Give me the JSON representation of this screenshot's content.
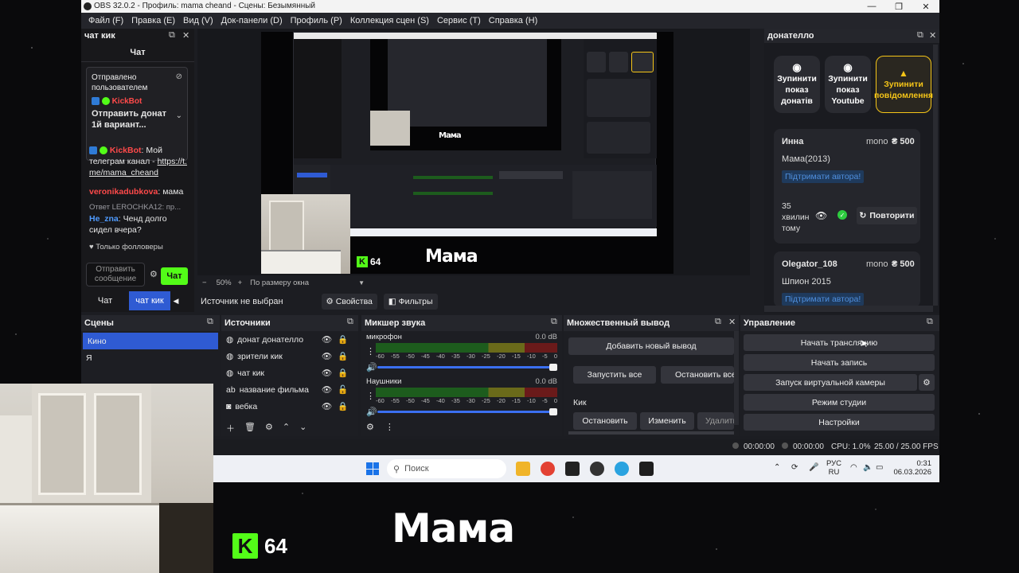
{
  "window": {
    "title": "OBS 32.0.2 - Профиль: mama cheand - Сцены: Безымянный",
    "controls": [
      "—",
      "❐",
      "✕"
    ]
  },
  "menu": [
    "Файл (F)",
    "Правка (E)",
    "Вид (V)",
    "Док-панели (D)",
    "Профиль (P)",
    "Коллекция сцен (S)",
    "Сервис (T)",
    "Справка (H)"
  ],
  "chat": {
    "dock_title": "чат кик",
    "header": "Чат",
    "pinned": {
      "sent_by": "Отправлено пользователем",
      "user": "KickBot",
      "text": "Отправить донат 1й вариант..."
    },
    "messages": [
      {
        "user": "KickBot",
        "text": ": Мой телеграм канал - ",
        "link": "https://t.me/mama_cheand"
      },
      {
        "user": "veronikadubkova",
        "text": ": мама"
      },
      {
        "reply": "Ответ LEROCHKA12: пр..."
      },
      {
        "user": "He_zna",
        "text": ": Ченд долго сидел вчера?"
      }
    ],
    "followers_only": "Только фолловеры",
    "input_placeholder": "Отправить сообщение",
    "send_label": "Чат",
    "tabs": [
      "Чат",
      "чат кик"
    ]
  },
  "preview": {
    "zoom": "50%",
    "fit_mode": "По размеру окна",
    "overlay_text": "Мама",
    "overlay_badge": "64",
    "no_source": "Источник не выбран",
    "properties_label": "Свойства",
    "filters_label": "Фильтры"
  },
  "donate": {
    "dock_title": "донателло",
    "buttons": [
      {
        "label": "Зупинити показ донатів",
        "icon": "stop-circle-icon"
      },
      {
        "label": "Зупинити показ Youtube",
        "icon": "stop-circle-icon"
      },
      {
        "label": "Зупинити повідомлення",
        "icon": "warning-icon"
      }
    ],
    "cards": [
      {
        "name": "Инна",
        "method": "mono",
        "amount": "₴ 500",
        "message": "Мама(2013)",
        "support": "Підтримати автора!",
        "ago_value": "35",
        "ago_unit": "хвилин тому",
        "repeat_label": "Повторити"
      },
      {
        "name": "Olegator_108",
        "method": "mono",
        "amount": "₴ 500",
        "message": "Шпион 2015",
        "support": "Підтримати автора!"
      }
    ]
  },
  "scenes": {
    "title": "Сцены",
    "items": [
      "Кино",
      "Я"
    ],
    "selected": 0
  },
  "sources": {
    "title": "Источники",
    "items": [
      {
        "label": "донат донателло",
        "icon": "globe-icon",
        "locked": true
      },
      {
        "label": "зрители кик",
        "icon": "globe-icon",
        "locked": true
      },
      {
        "label": "чат кик",
        "icon": "globe-icon",
        "locked": true
      },
      {
        "label": "название фильма",
        "icon": "text-icon",
        "locked": false
      },
      {
        "label": "вебка",
        "icon": "camera-icon",
        "locked": true
      }
    ]
  },
  "mixer": {
    "title": "Микшер звука",
    "channels": [
      {
        "name": "микрофон",
        "db": "0.0 dB"
      },
      {
        "name": "Наушники",
        "db": "0.0 dB"
      }
    ],
    "ticks": [
      "-60",
      "-55",
      "-50",
      "-45",
      "-40",
      "-35",
      "-30",
      "-25",
      "-20",
      "-15",
      "-10",
      "-5",
      "0"
    ]
  },
  "multi": {
    "title": "Множественный вывод",
    "add_label": "Добавить новый вывод",
    "start_all": "Запустить все",
    "stop_all": "Остановить все",
    "target": "Кик",
    "stop": "Остановить",
    "edit": "Изменить",
    "delete": "Удалить"
  },
  "controls": {
    "title": "Управление",
    "buttons": [
      "Начать трансляцию",
      "Начать запись",
      "Запуск виртуальной камеры",
      "Режим студии",
      "Настройки"
    ]
  },
  "status": {
    "stream_time": "00:00:00",
    "rec_time": "00:00:00",
    "cpu": "CPU: 1.0%",
    "fps": "25.00 / 25.00 FPS"
  },
  "taskbar": {
    "search": "Поиск",
    "lang": "РУС",
    "region": "RU",
    "time": "0:31",
    "date": "06.03.2026"
  },
  "colors": {
    "kick_green": "#53fc18",
    "accent_blue": "#2f5bd3",
    "donate_yellow": "#f5c518"
  }
}
